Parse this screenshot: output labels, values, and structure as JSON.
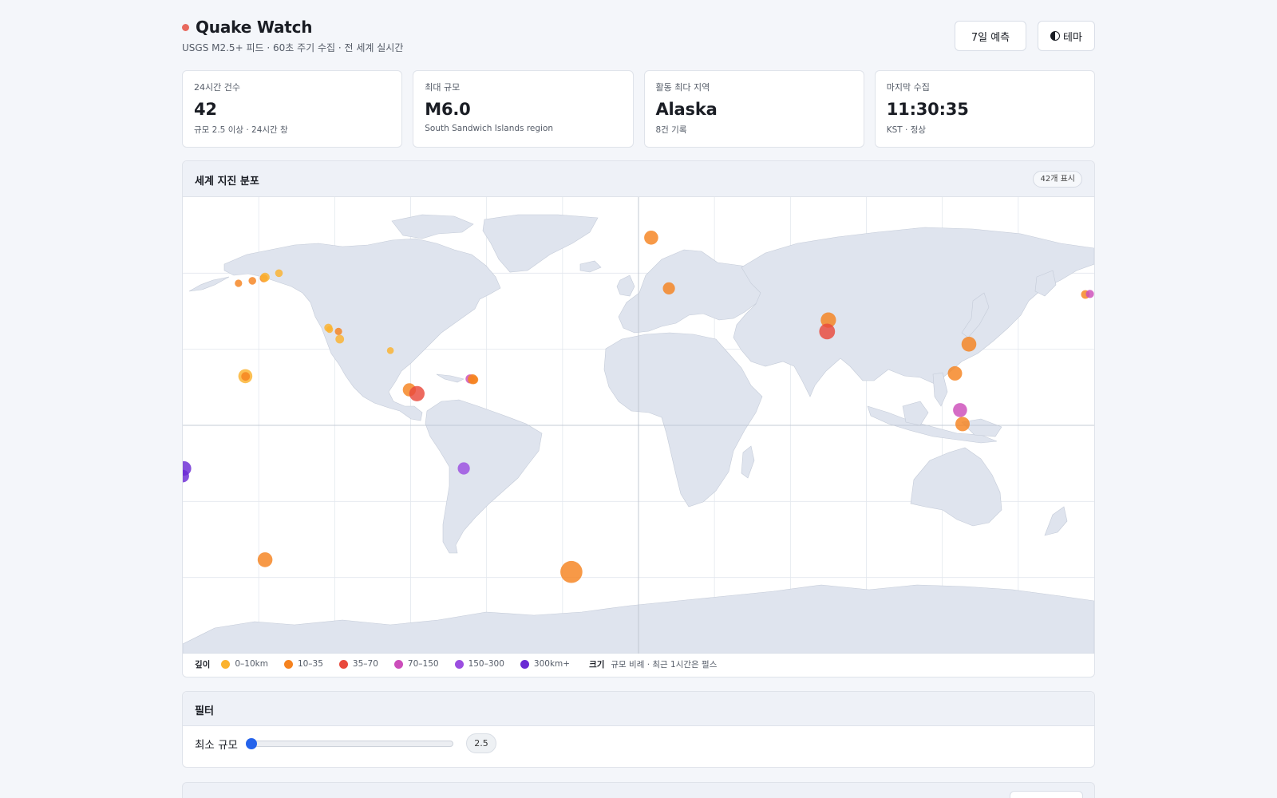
{
  "header": {
    "title": "Quake Watch",
    "subtitle": "USGS M2.5+ 피드 · 60초 주기 수집 · 전 세계 실시간",
    "forecast_button": "7일 예측",
    "theme_button": "테마",
    "theme_icon": "half-circle-icon",
    "live_color": "#e8695e"
  },
  "stats": [
    {
      "label": "24시간 건수",
      "value": "42",
      "note": "규모 2.5 이상 · 24시간 창"
    },
    {
      "label": "최대 규모",
      "value": "M6.0",
      "note": "South Sandwich Islands region"
    },
    {
      "label": "활동 최다 지역",
      "value": "Alaska",
      "note": "8건 기록"
    },
    {
      "label": "마지막 수집",
      "value": "11:30:35",
      "note": "KST · 정상"
    }
  ],
  "map": {
    "title": "세계 지진 분포",
    "count_badge": "42개 표시",
    "legend": {
      "depth_title": "깊이",
      "depth_items": [
        {
          "label": "0–10km",
          "color": "#fbb22e"
        },
        {
          "label": "10–35",
          "color": "#f5821f"
        },
        {
          "label": "35–70",
          "color": "#e9493c"
        },
        {
          "label": "70–150",
          "color": "#cc4dba"
        },
        {
          "label": "150–300",
          "color": "#9b4ee0"
        },
        {
          "label": "300km+",
          "color": "#6a2ad4"
        }
      ],
      "size_title": "크기",
      "size_note": "규모 비례 · 최근 1시간은 펄스"
    },
    "quakes": [
      {
        "lon": -158,
        "lat": 56,
        "mag": 2.7,
        "depth": 20
      },
      {
        "lon": -152.5,
        "lat": 57,
        "mag": 2.8,
        "depth": 25
      },
      {
        "lon": -148,
        "lat": 58,
        "mag": 2.9,
        "depth": 30
      },
      {
        "lon": -147.5,
        "lat": 58.4,
        "mag": 3.1,
        "depth": 8
      },
      {
        "lon": -142,
        "lat": 60,
        "mag": 2.8,
        "depth": 5
      },
      {
        "lon": -122.5,
        "lat": 38.5,
        "mag": 2.9,
        "depth": 5
      },
      {
        "lon": -122,
        "lat": 37.8,
        "mag": 2.6,
        "depth": 8
      },
      {
        "lon": -118.5,
        "lat": 37,
        "mag": 2.7,
        "depth": 15
      },
      {
        "lon": -118,
        "lat": 34,
        "mag": 3.0,
        "depth": 5
      },
      {
        "lon": -155.3,
        "lat": 19.4,
        "mag": 4.2,
        "depth": 6
      },
      {
        "lon": -155.2,
        "lat": 19.3,
        "mag": 3.0,
        "depth": 30
      },
      {
        "lon": -98,
        "lat": 29.5,
        "mag": 2.6,
        "depth": 5
      },
      {
        "lon": -90.5,
        "lat": 14,
        "mag": 4.0,
        "depth": 20
      },
      {
        "lon": -87.5,
        "lat": 12.5,
        "mag": 4.5,
        "depth": 45
      },
      {
        "lon": -66.5,
        "lat": 18.3,
        "mag": 3.1,
        "depth": 90
      },
      {
        "lon": -65.5,
        "lat": 18.2,
        "mag": 3.3,
        "depth": 20
      },
      {
        "lon": -65,
        "lat": 18,
        "mag": 3.0,
        "depth": 15
      },
      {
        "lon": -69,
        "lat": -17,
        "mag": 3.8,
        "depth": 160
      },
      {
        "lon": -179.5,
        "lat": -17,
        "mag": 4.3,
        "depth": 550
      },
      {
        "lon": -180,
        "lat": -20,
        "mag": 3.9,
        "depth": 400
      },
      {
        "lon": -147.5,
        "lat": -53,
        "mag": 4.4,
        "depth": 10
      },
      {
        "lon": -26.5,
        "lat": -57.8,
        "mag": 6.0,
        "depth": 10
      },
      {
        "lon": 5,
        "lat": 74,
        "mag": 4.2,
        "depth": 10
      },
      {
        "lon": 12,
        "lat": 54,
        "mag": 3.8,
        "depth": 10
      },
      {
        "lon": 75,
        "lat": 41.5,
        "mag": 4.5,
        "depth": 10
      },
      {
        "lon": 74.5,
        "lat": 37,
        "mag": 4.6,
        "depth": 40
      },
      {
        "lon": 130.5,
        "lat": 32,
        "mag": 4.4,
        "depth": 10
      },
      {
        "lon": 125,
        "lat": 20.5,
        "mag": 4.3,
        "depth": 10
      },
      {
        "lon": 127,
        "lat": 6,
        "mag": 4.2,
        "depth": 100
      },
      {
        "lon": 128,
        "lat": 0.5,
        "mag": 4.3,
        "depth": 10
      },
      {
        "lon": 176.5,
        "lat": 51.6,
        "mag": 3.0,
        "depth": 25
      },
      {
        "lon": 178.3,
        "lat": 51.8,
        "mag": 2.9,
        "depth": 120
      }
    ]
  },
  "filter": {
    "title": "필터",
    "min_mag_label": "최소 규모",
    "min_mag_value": "2.5",
    "min_mag_min": 2.5,
    "min_mag_max": 8
  }
}
